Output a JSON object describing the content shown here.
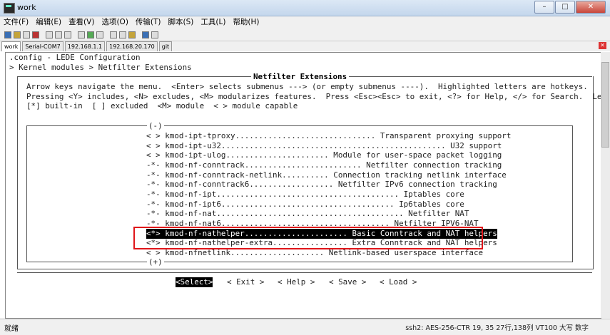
{
  "window": {
    "title": "work"
  },
  "menu": [
    "文件(F)",
    "编辑(E)",
    "查看(V)",
    "选项(O)",
    "传输(T)",
    "脚本(S)",
    "工具(L)",
    "帮助(H)"
  ],
  "tabs": [
    "work",
    "Serial-COM7",
    "192.168.1.1",
    "192.168.20.170",
    "git"
  ],
  "terminal": {
    "line1": ".config - LEDE Configuration",
    "line2": "> Kernel modules > Netfilter Extensions",
    "dialog_title": "Netfilter Extensions",
    "help1": "Arrow keys navigate the menu.  <Enter> selects submenus ---> (or empty submenus ----).  Highlighted letters are hotkeys.",
    "help2": "Pressing <Y> includes, <N> excludes, <M> modularizes features.  Press <Esc><Esc> to exit, <?> for Help, </> for Search.  Legend:",
    "help3": "[*] built-in  [ ] excluded  <M> module  < > module capable",
    "scroll_up": "(-)",
    "scroll_down": "(+)",
    "items": [
      "< > kmod-ipt-tproxy.............................. Transparent proxying support",
      "< > kmod-ipt-u32................................................ U32 support",
      "< > kmod-ipt-ulog...................... Module for user-space packet logging",
      "-*- kmod-nf-conntrack......................... Netfilter connection tracking",
      "-*- kmod-nf-conntrack-netlink.......... Connection tracking netlink interface",
      "-*- kmod-nf-conntrack6.................. Netfilter IPv6 connection tracking",
      "-*- kmod-nf-ipt....................................... Iptables core",
      "-*- kmod-nf-ipt6..................................... Ip6tables core",
      "-*- kmod-nf-nat........................................ Netfilter NAT",
      "-*- kmod-nf-nat6.................................... Netfilter IPV6-NAT",
      "<*> kmod-nf-nathelper...................... Basic Conntrack and NAT helpers",
      "<*> kmod-nf-nathelper-extra................ Extra Conntrack and NAT helpers",
      "< > kmod-nfnetlink.................... Netlink-based userspace interface"
    ],
    "buttons": [
      "<Select>",
      "< Exit >",
      "< Help >",
      "< Save >",
      "< Load >"
    ]
  },
  "status": {
    "left": "就绪",
    "right": "ssh2: AES-256-CTR   19, 35   27行,138列  VT100   大写  数字"
  }
}
